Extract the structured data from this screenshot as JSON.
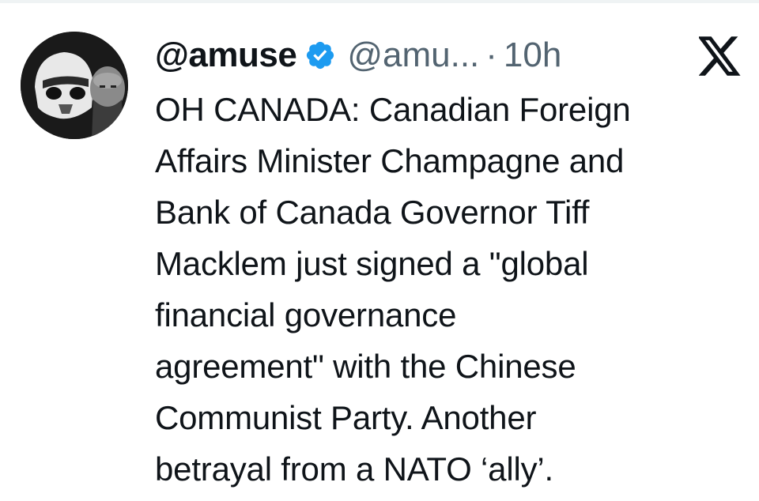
{
  "tweet": {
    "display_name": "@amuse",
    "handle": "@amu...",
    "separator": "·",
    "time": "10h",
    "text": "OH CANADA: Canadian Foreign\nAffairs Minister Champagne and\nBank of Canada Governor Tiff\nMacklem just signed a \"global\nfinancial governance\nagreement\" with the Chinese\nCommunist Party. Another\nbetrayal from a NATO ‘ally’."
  },
  "colors": {
    "verified": "#1d9bf0",
    "secondary_text": "#536471",
    "primary_text": "#0f1419"
  },
  "icons": {
    "verified": "verified-badge-icon",
    "platform": "x-logo-icon"
  }
}
